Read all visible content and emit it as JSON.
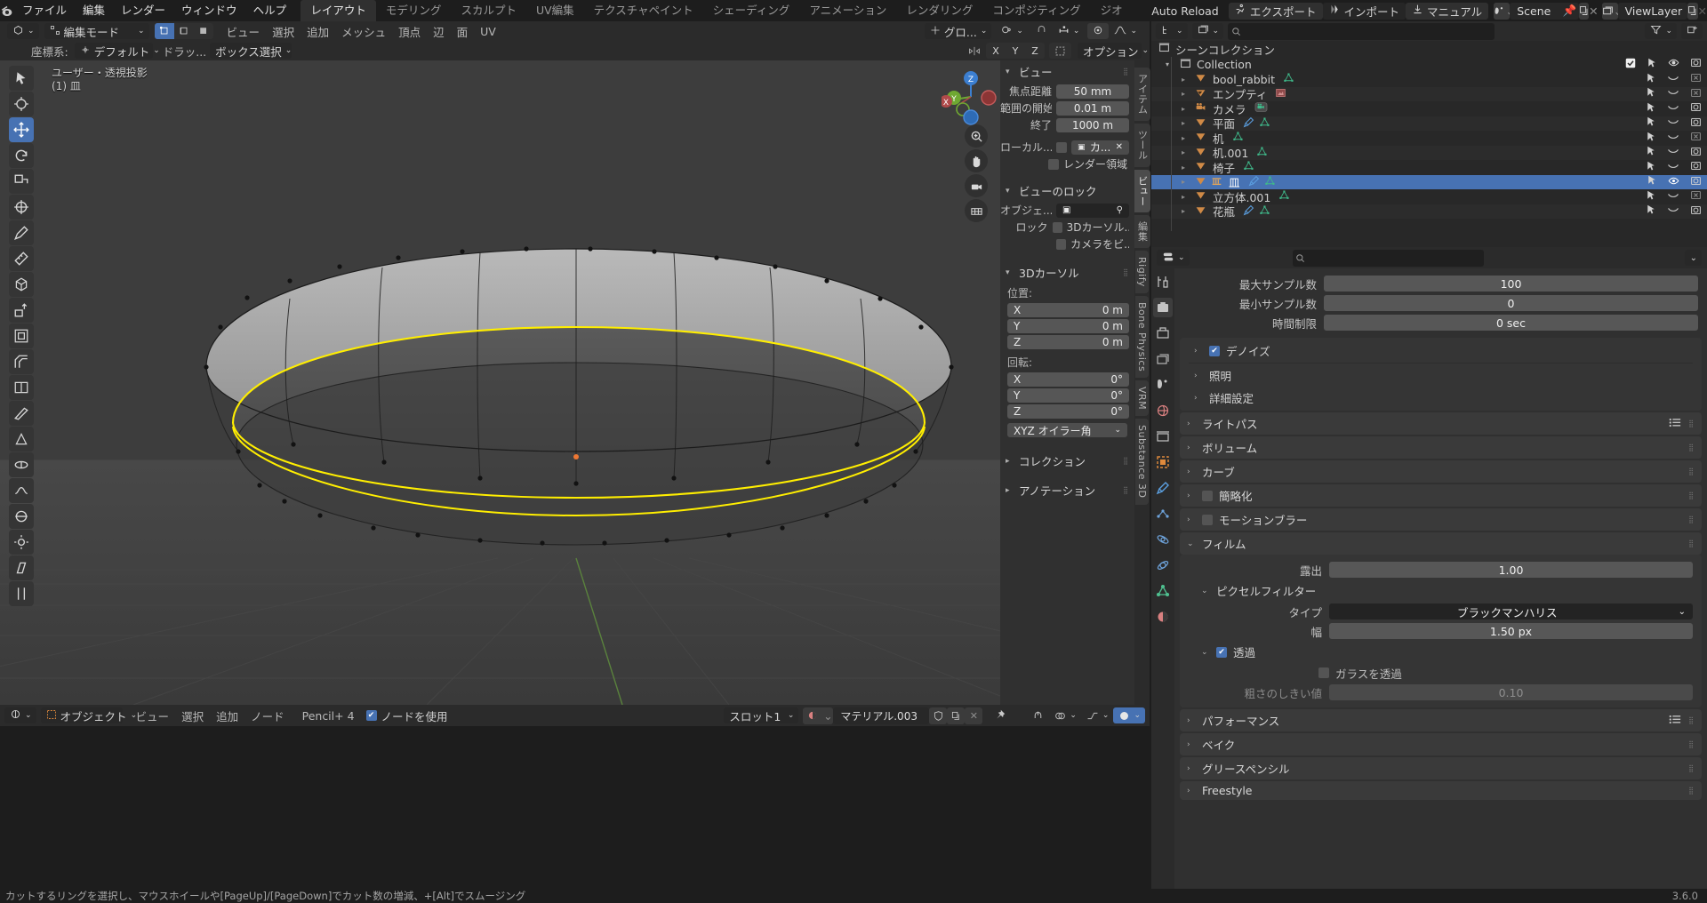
{
  "app": {
    "version": "3.6.0"
  },
  "topbar": {
    "logo_icon": "blender-logo-icon",
    "menus": [
      "ファイル",
      "編集",
      "レンダー",
      "ウィンドウ",
      "ヘルプ"
    ],
    "workspaces": [
      "レイアウト",
      "モデリング",
      "スカルプト",
      "UV編集",
      "テクスチャペイント",
      "シェーディング",
      "アニメーション",
      "レンダリング",
      "コンポジティング",
      "ジオ"
    ],
    "active_workspace": "レイアウト",
    "auto_reload": "Auto Reload",
    "addon_buttons": [
      {
        "label": "エクスポート",
        "icon": "export-icon"
      },
      {
        "label": "インポート",
        "icon": "import-icon"
      },
      {
        "label": "マニュアル",
        "icon": "download-icon"
      }
    ],
    "scene_field": {
      "icon": "scene-icon",
      "value": "Scene",
      "pin_icon": "pin-icon",
      "copy_icon": "copy-icon",
      "close_icon": "close-icon"
    },
    "viewlayer_field": {
      "icon": "viewlayer-icon",
      "value": "ViewLayer",
      "copy_icon": "copy-icon",
      "close_icon": "close-icon"
    }
  },
  "viewport_header": {
    "editor_icon": "editor-type-icon",
    "mode": "編集モード",
    "select_modes": [
      "vertex-select-icon",
      "edge-select-icon",
      "face-select-icon"
    ],
    "active_select_mode": 0,
    "menus": [
      "ビュー",
      "選択",
      "追加",
      "メッシュ",
      "頂点",
      "辺",
      "面",
      "UV"
    ],
    "transform_orient": "グロ...",
    "snap_icon": "magnet-icon",
    "proportional_icon": "proportional-edit-icon",
    "overlay_icons": [
      "show-gizmo-icon",
      "overlays-icon",
      "xray-icon"
    ],
    "shading_modes": [
      "wireframe-icon",
      "solid-icon",
      "material-preview-icon",
      "rendered-icon"
    ],
    "active_shading": 1
  },
  "tool_header": {
    "label": "座標系:",
    "orientation_icon": "orientation-icon",
    "orientation": "デフォルト",
    "drag_label": "ドラッ...",
    "drag_value": "ボックス選択",
    "mirror_label": "X Y Z",
    "mirror_icon": "mirror-icon",
    "snap_toggle_icon": "snap-icon",
    "options_label": "オプション"
  },
  "viewport": {
    "view_info_line1": "ユーザー・透視投影",
    "view_info_line2": "(1) 皿",
    "gizmo_axes": [
      "Z",
      "Y",
      "X"
    ],
    "nav_buttons": [
      "zoom-icon",
      "hand-icon",
      "camera-icon",
      "orthographic-icon"
    ],
    "toolbar_tools": [
      "tweak-tool-icon",
      "cursor-tool-icon",
      "move-tool-icon",
      "rotate-tool-icon",
      "scale-tool-icon",
      "transform-tool-icon",
      "annotate-tool-icon",
      "measure-tool-icon",
      "add-cube-tool-icon",
      "extrude-tool-icon",
      "inset-faces-tool-icon",
      "bevel-tool-icon",
      "loop-cut-tool-icon",
      "knife-tool-icon",
      "poly-build-tool-icon",
      "spin-tool-icon",
      "smooth-tool-icon",
      "edge-slide-tool-icon",
      "shrink-fatten-tool-icon",
      "shear-tool-icon",
      "rip-region-tool-icon"
    ],
    "active_tool_index": 2
  },
  "npanel": {
    "tabs": [
      "アイテム",
      "ツール",
      "ビュー",
      "編集",
      "Rigify",
      "Bone Physics",
      "VRM",
      "Substance 3D"
    ],
    "active_tab": "ビュー",
    "sections": [
      {
        "title": "ビュー",
        "rows": [
          {
            "label": "焦点距離",
            "value": "50 mm"
          },
          {
            "label": "範囲の開始",
            "value": "0.01 m"
          },
          {
            "label": "終了",
            "value": "1000 m"
          }
        ],
        "local_label": "ローカル...",
        "local_checked": false,
        "local_value": "カ...",
        "render_region_label": "レンダー領域",
        "render_region_checked": false
      },
      {
        "title": "ビューのロック",
        "object_label": "オブジェ...",
        "object_value": "",
        "lock_label": "ロック",
        "lock_cursor_label": "3Dカーソル...",
        "lock_cursor_checked": false,
        "lock_camera_label": "カメラをビ...",
        "lock_camera_checked": false
      },
      {
        "title": "3Dカーソル",
        "position_label": "位置:",
        "position": [
          {
            "label": "X",
            "value": "0 m"
          },
          {
            "label": "Y",
            "value": "0 m"
          },
          {
            "label": "Z",
            "value": "0 m"
          }
        ],
        "rotation_label": "回転:",
        "rotation": [
          {
            "label": "X",
            "value": "0°"
          },
          {
            "label": "Y",
            "value": "0°"
          },
          {
            "label": "Z",
            "value": "0°"
          }
        ],
        "rotation_mode": "XYZ オイラー角"
      },
      {
        "title": "コレクション"
      },
      {
        "title": "アノテーション"
      }
    ]
  },
  "outliner": {
    "header": {
      "display_mode_icon": "outliner-display-mode-icon",
      "filter_type_icon": "outliner-filter-type-icon",
      "search_placeholder": "",
      "search_icon": "search-icon",
      "filter_icon": "filter-icon",
      "new_collection_icon": "new-collection-icon"
    },
    "scene_collection": "シーンコレクション",
    "collection": {
      "name": "Collection",
      "checkbox": true,
      "icons": [
        "select-icon",
        "eye-icon",
        "camera-icon"
      ]
    },
    "items": [
      {
        "name": "bool_rabbit",
        "icon": "mesh-icon",
        "data_icons": [
          "mesh-data-icon"
        ],
        "selected": false,
        "hidden_render": true
      },
      {
        "name": "エンプティ",
        "icon": "empty-image-icon",
        "data_icons": [
          "image-data-icon"
        ],
        "selected": false,
        "hidden_render": true
      },
      {
        "name": "カメラ",
        "icon": "camera-object-icon",
        "data_icons": [
          "camera-data-icon"
        ],
        "selected": false,
        "hidden_render": false
      },
      {
        "name": "平面",
        "icon": "mesh-icon",
        "data_icons": [
          "modifier-icon",
          "mesh-data-icon"
        ],
        "selected": false,
        "hidden_render": false
      },
      {
        "name": "机",
        "icon": "mesh-icon",
        "data_icons": [
          "mesh-data-icon"
        ],
        "selected": false,
        "hidden_render": true
      },
      {
        "name": "机.001",
        "icon": "mesh-icon",
        "data_icons": [
          "mesh-data-icon"
        ],
        "selected": false,
        "hidden_render": false
      },
      {
        "name": "椅子",
        "icon": "mesh-icon",
        "data_icons": [
          "mesh-data-icon"
        ],
        "selected": false,
        "hidden_render": false
      },
      {
        "name": "皿",
        "icon": "mesh-icon",
        "data_icons": [
          "modifier-icon",
          "mesh-data-icon"
        ],
        "selected": true,
        "hidden_render": false
      },
      {
        "name": "立方体.001",
        "icon": "mesh-icon",
        "data_icons": [
          "mesh-data-icon"
        ],
        "selected": false,
        "hidden_render": true
      },
      {
        "name": "花瓶",
        "icon": "mesh-icon",
        "data_icons": [
          "modifier-icon",
          "mesh-data-icon"
        ],
        "selected": false,
        "hidden_render": false
      }
    ]
  },
  "properties": {
    "header": {
      "editor_icon": "properties-editor-icon",
      "search_placeholder": "",
      "search_icon": "search-icon",
      "menu_icon": "chevron-down-icon"
    },
    "tabs": [
      "tool-tab-icon",
      "render-tab-icon",
      "output-tab-icon",
      "viewlayer-tab-icon",
      "scene-tab-icon",
      "world-tab-icon",
      "collection-tab-icon",
      "object-tab-icon",
      "modifier-tab-icon",
      "particles-tab-icon",
      "physics-tab-icon",
      "constraint-tab-icon",
      "data-tab-icon",
      "material-tab-icon"
    ],
    "active_tab_index": 1,
    "sampling": [
      {
        "label": "最大サンプル数",
        "value": "100"
      },
      {
        "label": "最小サンプル数",
        "value": "0"
      },
      {
        "label": "時間制限",
        "value": "0 sec"
      }
    ],
    "sub_panels": [
      {
        "label": "デノイズ",
        "checkbox": true,
        "expanded": false
      },
      {
        "label": "照明",
        "checkbox": null,
        "expanded": false
      },
      {
        "label": "詳細設定",
        "checkbox": null,
        "expanded": false
      }
    ],
    "panels": [
      {
        "label": "ライトパス",
        "expanded": false,
        "checkbox": null,
        "has_preset": true
      },
      {
        "label": "ボリューム",
        "expanded": false,
        "checkbox": null
      },
      {
        "label": "カーブ",
        "expanded": false,
        "checkbox": null
      },
      {
        "label": "簡略化",
        "expanded": false,
        "checkbox": false
      },
      {
        "label": "モーションブラー",
        "expanded": false,
        "checkbox": false
      }
    ],
    "film": {
      "label": "フィルム",
      "exposure_label": "露出",
      "exposure_value": "1.00",
      "pixel_filter_label": "ピクセルフィルター",
      "type_label": "タイプ",
      "type_value": "ブラックマンハリス",
      "width_label": "幅",
      "width_value": "1.50 px",
      "transparent_label": "透過",
      "transparent_checked": true,
      "glass_label": "ガラスを透過",
      "glass_checked": false,
      "roughness_label": "粗さのしきい値",
      "roughness_value": "0.10"
    },
    "bottom_panels": [
      {
        "label": "パフォーマンス",
        "has_preset": true
      },
      {
        "label": "ベイク"
      },
      {
        "label": "グリースペンシル"
      },
      {
        "label": "Freestyle",
        "checkbox": false
      }
    ]
  },
  "shader_editor": {
    "editor_icon": "shader-editor-icon",
    "shader_type_icon": "object-icon",
    "shader_type": "オブジェクト",
    "menus": [
      "ビュー",
      "選択",
      "追加",
      "ノード"
    ],
    "pencil_label": "Pencil+ 4",
    "use_nodes_label": "ノードを使用",
    "use_nodes_checked": true,
    "slot_label": "スロット1",
    "material_icon": "material-icon",
    "material_name": "マテリアル.003",
    "shield_icon": "shield-icon",
    "copy_icon": "copy-icon",
    "close_icon": "close-icon",
    "pin_icon": "pin-icon",
    "right_icons": [
      "snap-icon",
      "overlay-icon",
      "proportional-icon",
      "shading-icon"
    ]
  },
  "statusbar": {
    "message": "カットするリングを選択し、マウスホイールや[PageUp]/[PageDown]でカット数の増減、+[Alt]でスムージング",
    "version": "3.6.0"
  },
  "colors": {
    "accent": "#4772b3",
    "selected_edge": "#ffee00",
    "bg_dark": "#1d1d1d",
    "bg_panel": "#303030",
    "bg_header": "#2b2b2b",
    "viewport_bg": "#3d3d3d",
    "mesh_orange": "#e2954a",
    "cursor_orange": "#ee7733"
  }
}
